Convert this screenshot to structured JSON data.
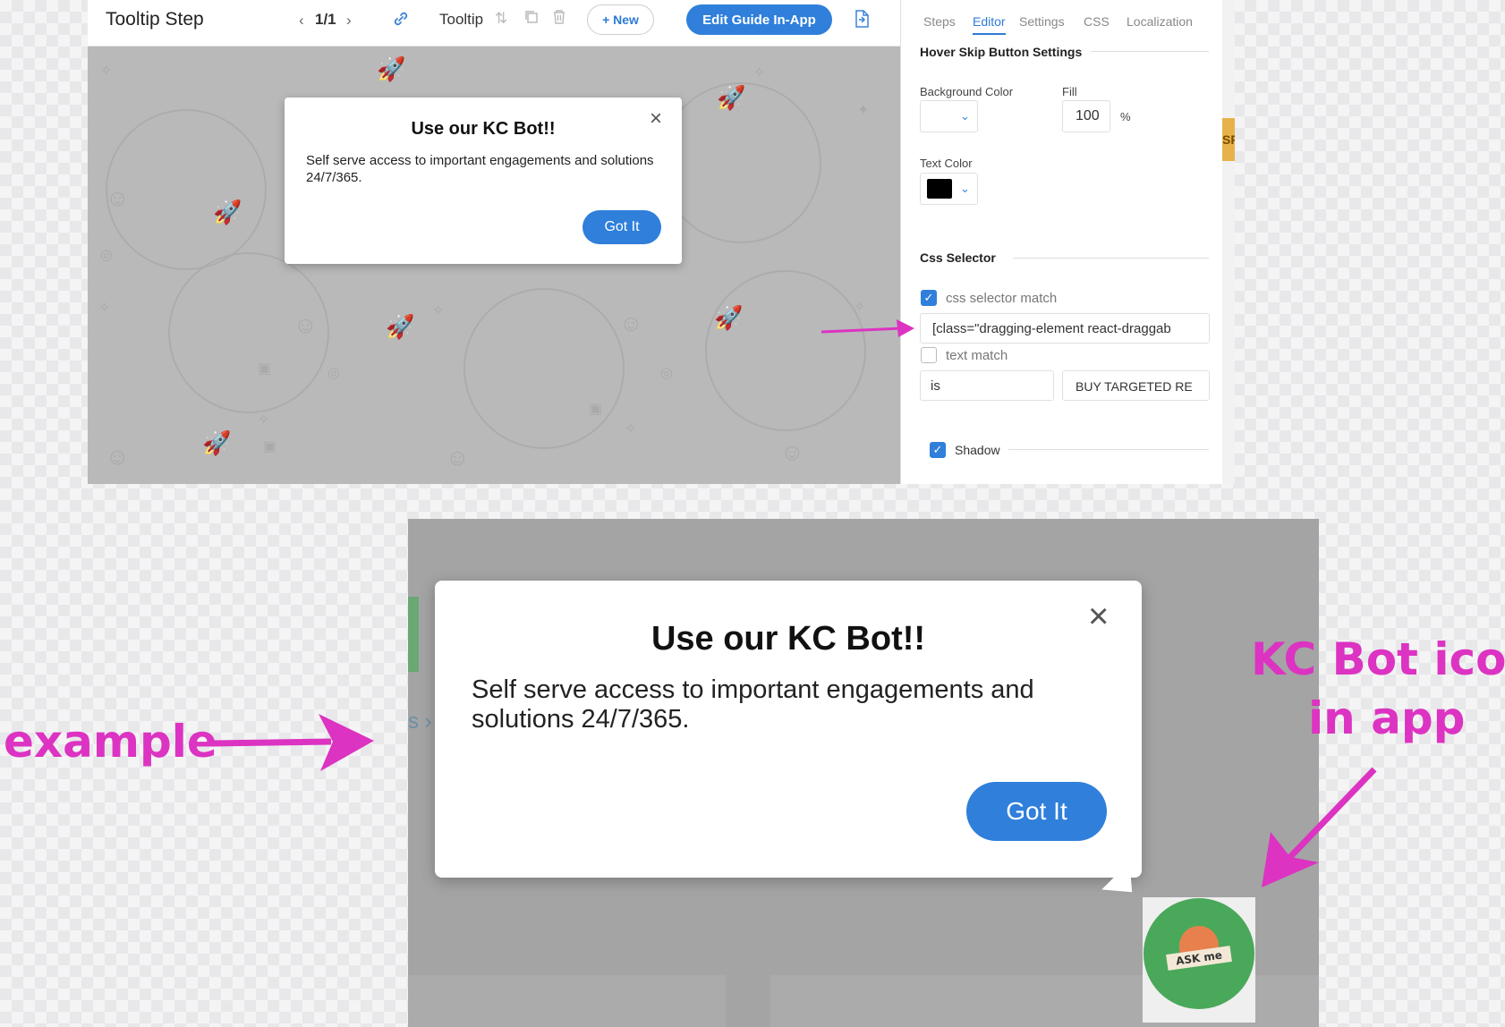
{
  "toolbar": {
    "title": "Tooltip Step",
    "pager": "1/1",
    "step_type": "Tooltip",
    "new_label": "+ New",
    "edit_in_app_label": "Edit Guide In-App"
  },
  "tooltip": {
    "title": "Use our KC Bot!!",
    "body": "Self serve access to important engagements and solutions 24/7/365.",
    "button": "Got It",
    "close": "×"
  },
  "panel": {
    "tabs": [
      "Steps",
      "Editor",
      "Settings",
      "CSS",
      "Localization"
    ],
    "active_tab": "Editor",
    "hover_section_title": "Hover Skip Button Settings",
    "background_color_label": "Background Color",
    "fill_label": "Fill",
    "fill_value": "100",
    "fill_unit": "%",
    "text_color_label": "Text Color",
    "text_color_value": "#000000",
    "css_selector_title": "Css Selector",
    "css_selector_match_label": "css selector match",
    "css_selector_match_checked": true,
    "css_selector_value": "[class=\"dragging-element react-draggab",
    "text_match_label": "text match",
    "text_match_checked": false,
    "text_match_operator": "is",
    "text_match_value": "BUY TARGETED RE",
    "shadow_label": "Shadow",
    "shadow_checked": true
  },
  "right_edge_tab": "SP",
  "bot_icon": {
    "label": "ASK me"
  },
  "annotations": {
    "example": "example",
    "kc_bot_line1": "KC Bot icon",
    "kc_bot_line2": "in app",
    "accent_color": "#dc33c2"
  },
  "colors": {
    "primary": "#2f7fdb",
    "canvas": "#b9b9b9",
    "bot_green": "#4aa85a"
  }
}
